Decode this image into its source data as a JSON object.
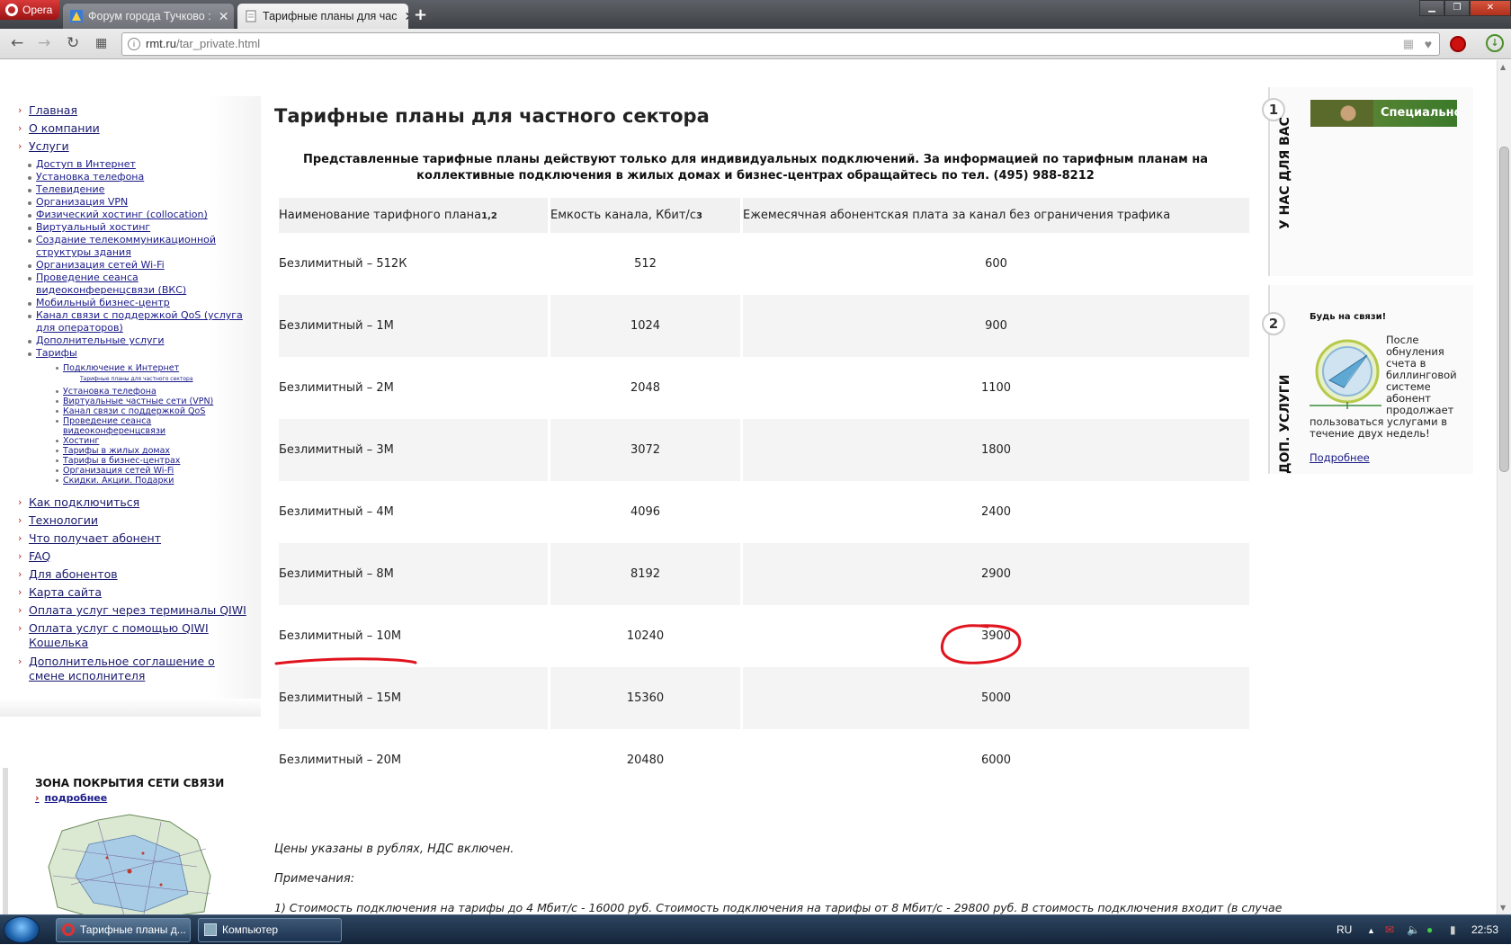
{
  "browser": {
    "menu_label": "Opera",
    "tabs": [
      {
        "label": "Форум города Тучково :"
      },
      {
        "label": "Тарифные планы для час"
      }
    ],
    "new_tab": "+",
    "address_host": "rmt.ru",
    "address_path": "/tar_private.html"
  },
  "nav": {
    "top": [
      {
        "label": "Главная"
      },
      {
        "label": "О компании"
      },
      {
        "label": "Услуги"
      }
    ],
    "services": [
      "Доступ в Интернет",
      "Установка телефона",
      "Телевидение",
      "Организация VPN",
      "Физический хостинг (collocation)",
      "Виртуальный хостинг",
      "Создание телекоммуникационной структуры здания",
      "Организация сетей Wi-Fi",
      "Проведение сеанса видеоконференцсвязи (ВКС)",
      "Мобильный бизнес-центр",
      "Канал связи с поддержкой QoS (услуга для операторов)",
      "Дополнительные услуги",
      "Тарифы"
    ],
    "tariffs_sub": {
      "internet": "Подключение к Интернет",
      "current": "Тарифные планы для частного сектора",
      "items": [
        "Установка телефона",
        "Виртуальные частные сети (VPN)",
        "Канал связи с поддержкой QoS",
        "Проведение сеанса видеоконференцсвязи",
        "Хостинг",
        "Тарифы в жилых домах",
        "Тарифы в бизнес-центрах",
        "Организация сетей Wi-Fi",
        "Скидки. Акции. Подарки"
      ]
    },
    "bottom": [
      "Как подключиться",
      "Технологии",
      "Что получает абонент",
      "FAQ",
      "Для абонентов",
      "Карта сайта",
      "Оплата услуг через терминалы QIWI",
      "Оплата услуг с помощью QIWI Кошелька",
      "Дополнительное соглашение о смене исполнителя"
    ]
  },
  "coverage": {
    "title": "ЗОНА ПОКРЫТИЯ СЕТИ СВЯЗИ",
    "more": "подробнее"
  },
  "main": {
    "title": "Тарифные планы для частного сектора",
    "notice": "Представленные тарифные планы действуют только для индивидуальных подключений. За информацией по тарифным планам на коллективные подключения в жилых домах и бизнес-центрах обращайтесь по тел. (495) 988-8212",
    "table": {
      "headers": [
        {
          "text": "Наименование тарифного плана",
          "sup": "1,2"
        },
        {
          "text": "Емкость канала, Кбит/с",
          "sup": "3"
        },
        {
          "text": "Ежемесячная абонентская плата за канал без ограничения трафика",
          "sup": ""
        }
      ],
      "rows": [
        {
          "name": "Безлимитный – 512К",
          "capacity": "512",
          "price": "600"
        },
        {
          "name": "Безлимитный – 1М",
          "capacity": "1024",
          "price": "900"
        },
        {
          "name": "Безлимитный – 2М",
          "capacity": "2048",
          "price": "1100"
        },
        {
          "name": "Безлимитный – 3М",
          "capacity": "3072",
          "price": "1800"
        },
        {
          "name": "Безлимитный – 4М",
          "capacity": "4096",
          "price": "2400"
        },
        {
          "name": "Безлимитный – 8М",
          "capacity": "8192",
          "price": "2900"
        },
        {
          "name": "Безлимитный – 10М",
          "capacity": "10240",
          "price": "3900"
        },
        {
          "name": "Безлимитный – 15М",
          "capacity": "15360",
          "price": "5000"
        },
        {
          "name": "Безлимитный – 20М",
          "capacity": "20480",
          "price": "6000"
        }
      ]
    },
    "prices_note": "Цены указаны в рублях, НДС включен.",
    "notes_title": "Примечания:",
    "note1": "1) Стоимость подключения на тарифы до 4 Мбит/с - 16000 руб. Стоимость подключения на тарифы от 8 Мбит/с - 29800 руб. В стоимость подключения входит (в случае"
  },
  "right": {
    "block1_num": "1",
    "block1_label": "У НАС ДЛЯ ВАС",
    "promo_text": "Специальное",
    "block2_num": "2",
    "block2_label": "ДОП. УСЛУГИ",
    "keep_title": "Будь на связи!",
    "keep_text_lines": [
      "После",
      "обнуления",
      "счета в",
      "биллинговой",
      "системе",
      "абонент",
      "продолжает",
      "пользоваться услугами в",
      "течение двух недель!"
    ],
    "keep_more": "Подробнее"
  },
  "taskbar": {
    "tasks": [
      "Тарифные планы д...",
      "Компьютер"
    ],
    "lang": "RU",
    "clock": "22:53"
  },
  "colors": {
    "link": "#1a1a6e",
    "arrow": "#b22222",
    "annotation": "#e0141e"
  }
}
